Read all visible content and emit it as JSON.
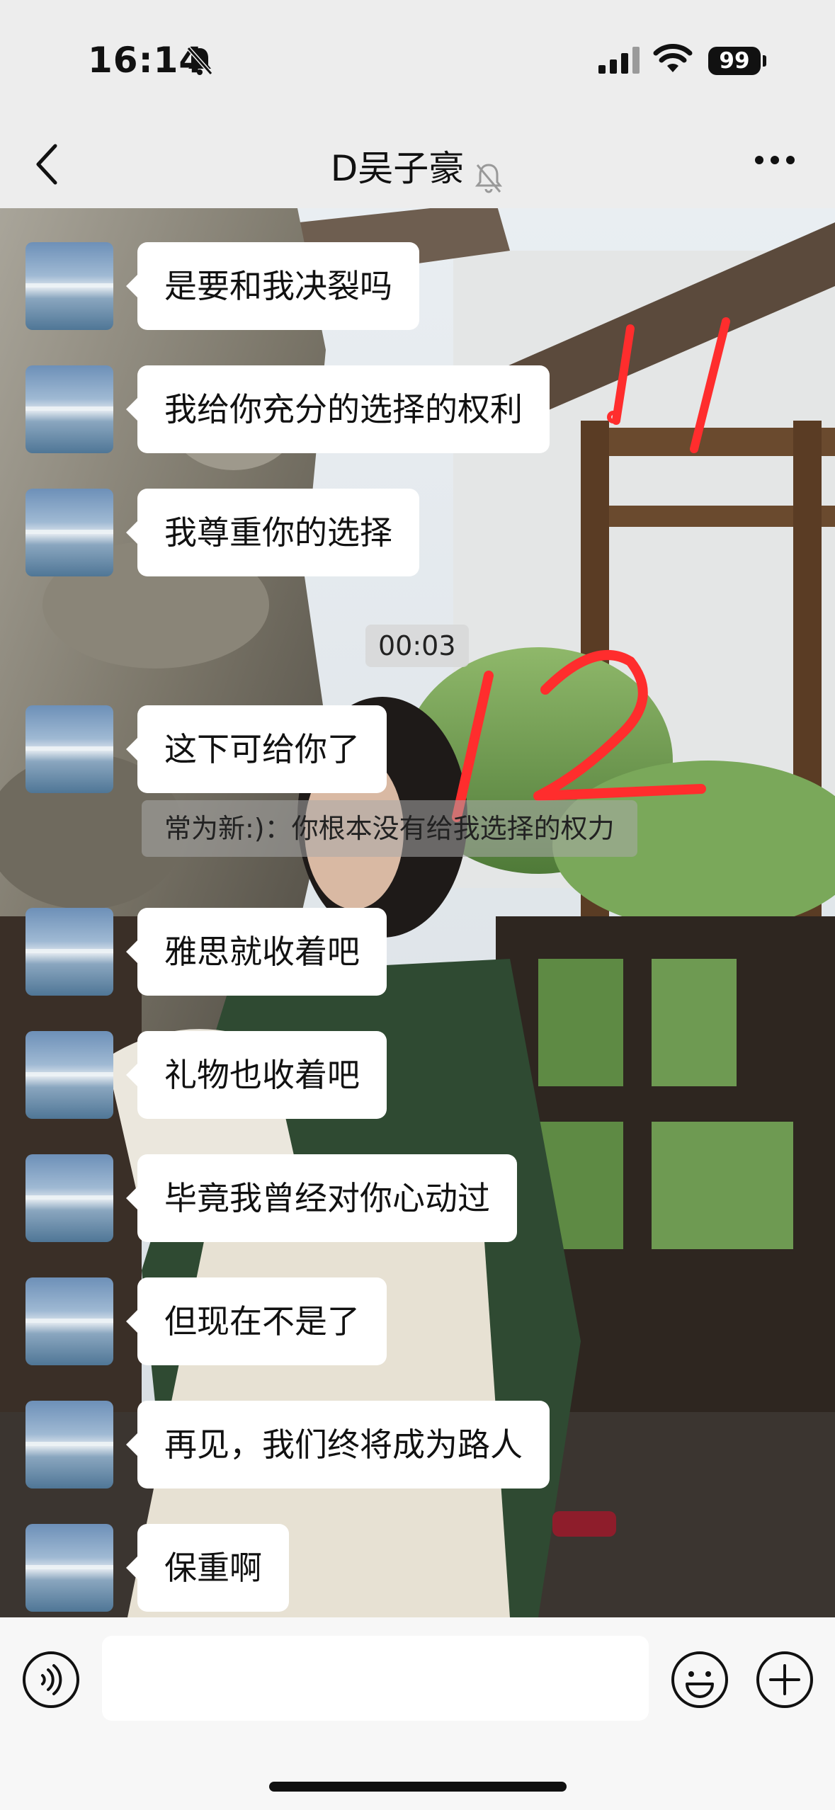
{
  "status": {
    "time": "16:14",
    "battery": "99"
  },
  "nav": {
    "title": "D吴子豪"
  },
  "chat": {
    "timestamp": "00:03",
    "system_message": "常为新:)：你根本没有给我选择的权力",
    "messages": [
      "是要和我决裂吗",
      "我给你充分的选择的权利",
      "我尊重你的选择",
      "这下可给你了",
      "雅思就收着吧",
      "礼物也收着吧",
      "毕竟我曾经对你心动过",
      "但现在不是了",
      "再见，我们终将成为路人",
      "保重啊"
    ],
    "annotations": [
      "11",
      "12"
    ]
  },
  "colors": {
    "bubble": "#ffffff",
    "annotation": "#ff2d2d",
    "page_bg": "#ededed"
  }
}
